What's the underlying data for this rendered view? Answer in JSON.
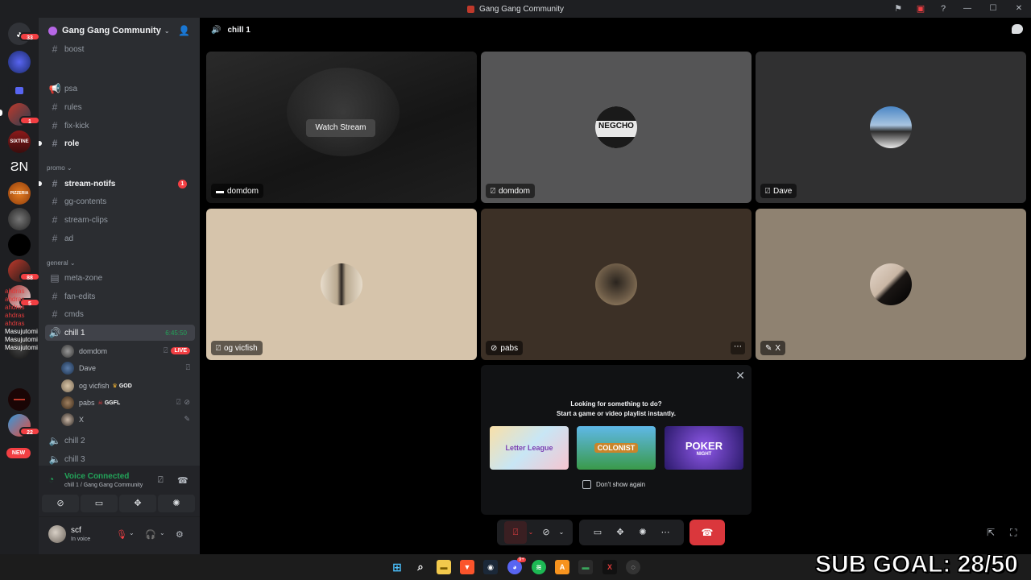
{
  "window": {
    "title": "Gang Gang Community"
  },
  "rail": {
    "badges": [
      "33",
      "1",
      "88",
      "5",
      "22"
    ],
    "new_label": "NEW"
  },
  "overlay_chat": [
    "ahdras",
    "ahdras",
    "ahdras",
    "ahdras",
    "ahdras",
    "Masujutomi",
    "Masujutomi",
    "Masujutomi"
  ],
  "guild": {
    "name": "Gang Gang Community"
  },
  "channels": {
    "boost": "boost",
    "psa": "psa",
    "rules": "rules",
    "fix_kick": "fix-kick",
    "role": "role",
    "cat_promo": "promo",
    "stream_notifs": "stream-notifs",
    "stream_notifs_count": "1",
    "gg_contents": "gg-contents",
    "stream_clips": "stream-clips",
    "ad": "ad",
    "cat_general": "general",
    "meta_zone": "meta-zone",
    "fan_edits": "fan-edits",
    "cmds": "cmds",
    "chill1": "chill 1",
    "chill1_timer": "6:45:50",
    "chill2": "chill 2",
    "chill3": "chill 3"
  },
  "voice_users": [
    {
      "name": "domdom",
      "live": "LIVE"
    },
    {
      "name": "Dave"
    },
    {
      "name": "og vicfish",
      "tag": "GOD"
    },
    {
      "name": "pabs",
      "tag": "GGFL"
    },
    {
      "name": "X"
    }
  ],
  "voice_panel": {
    "status": "Voice Connected",
    "location": "chill 1 / Gang Gang Community"
  },
  "user": {
    "name": "scf",
    "status": "In voice"
  },
  "main": {
    "channel": "chill 1",
    "watch_stream": "Watch Stream",
    "tiles": [
      {
        "name": "domdom"
      },
      {
        "name": "domdom",
        "avatar_text": "NEGCHO"
      },
      {
        "name": "Dave"
      },
      {
        "name": "og vicfish"
      },
      {
        "name": "pabs"
      },
      {
        "name": "X"
      }
    ]
  },
  "activity": {
    "line1": "Looking for something to do?",
    "line2": "Start a game or video playlist instantly.",
    "games": [
      "Letter League",
      "COLONIST",
      "POKER"
    ],
    "games_sub": [
      "",
      "",
      "NIGHT"
    ],
    "dont_show": "Don't show again"
  },
  "taskbar": {
    "discord_badge": "9+"
  },
  "overlay_goal": "SUB GOAL: 28/50",
  "colors": {
    "accent_green": "#23a55a",
    "danger_red": "#da373c",
    "sidebar_bg": "#2b2d31",
    "rail_bg": "#1e1f22"
  }
}
